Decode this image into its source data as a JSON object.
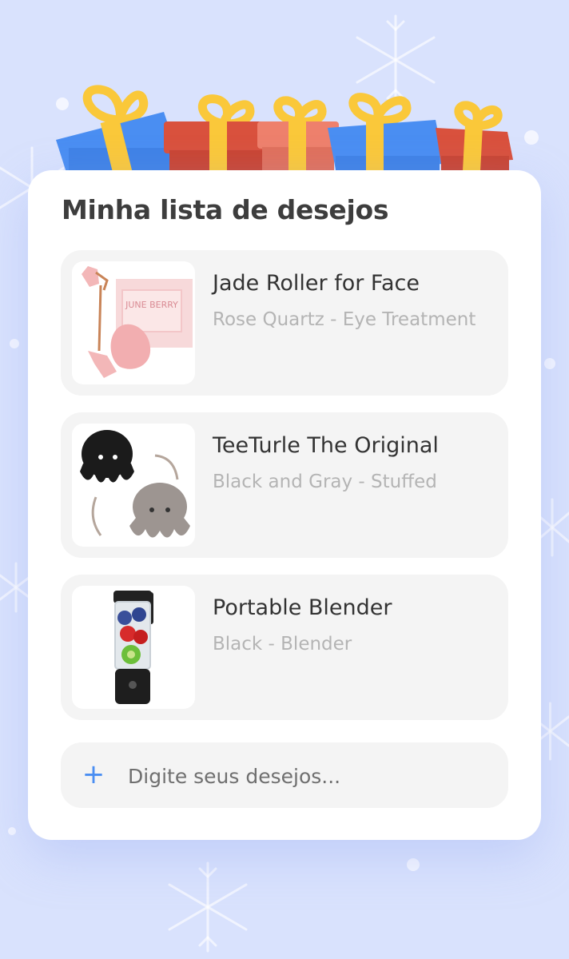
{
  "wishlist": {
    "title": "Minha lista de desejos",
    "items": [
      {
        "name": "Jade Roller for Face",
        "subtitle": "Rose Quartz - Eye Treatment",
        "image": "jade-roller-image"
      },
      {
        "name": "TeeTurle The Original",
        "subtitle": "Black and Gray - Stuffed",
        "image": "octopus-plush-image"
      },
      {
        "name": "Portable Blender",
        "subtitle": "Black - Blender",
        "image": "portable-blender-image"
      }
    ],
    "add_input": {
      "placeholder": "Digite seus desejos...",
      "value": "",
      "icon": "plus-icon"
    },
    "box_logo_text": "JUNE BERRY"
  },
  "colors": {
    "background": "#d9e2fd",
    "card": "#ffffff",
    "item_bg": "#f4f4f4",
    "accent": "#4a8ef2",
    "gift_blue": "#4a8ef2",
    "gift_red": "#d9513d",
    "gift_coral": "#ee806c",
    "ribbon_yellow": "#fac83a"
  }
}
